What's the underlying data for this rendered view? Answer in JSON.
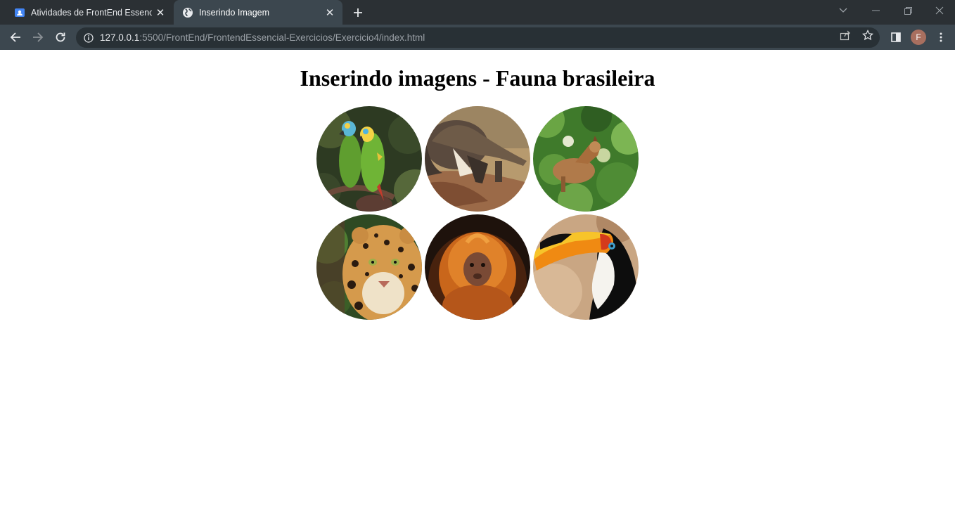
{
  "browser": {
    "tabs": [
      {
        "title": "Atividades de FrontEnd Essencial",
        "active": false,
        "icon": "classroom-icon"
      },
      {
        "title": "Inserindo Imagem",
        "active": true,
        "icon": "globe-icon"
      }
    ],
    "address": {
      "host": "127.0.0.1",
      "rest": ":5500/FrontEnd/FrontendEssencial-Exercicios/Exercicio4/index.html"
    },
    "profile_initial": "F"
  },
  "page": {
    "heading": "Inserindo imagens - Fauna brasileira",
    "images": [
      {
        "subject": "macaws",
        "icon": "parrots-image"
      },
      {
        "subject": "anteater",
        "icon": "anteater-image"
      },
      {
        "subject": "wild-dog",
        "icon": "maned-wolf-image"
      },
      {
        "subject": "jaguar",
        "icon": "jaguar-image"
      },
      {
        "subject": "golden-lion-tamarin",
        "icon": "tamarin-image"
      },
      {
        "subject": "toucan",
        "icon": "toucan-image"
      }
    ]
  }
}
